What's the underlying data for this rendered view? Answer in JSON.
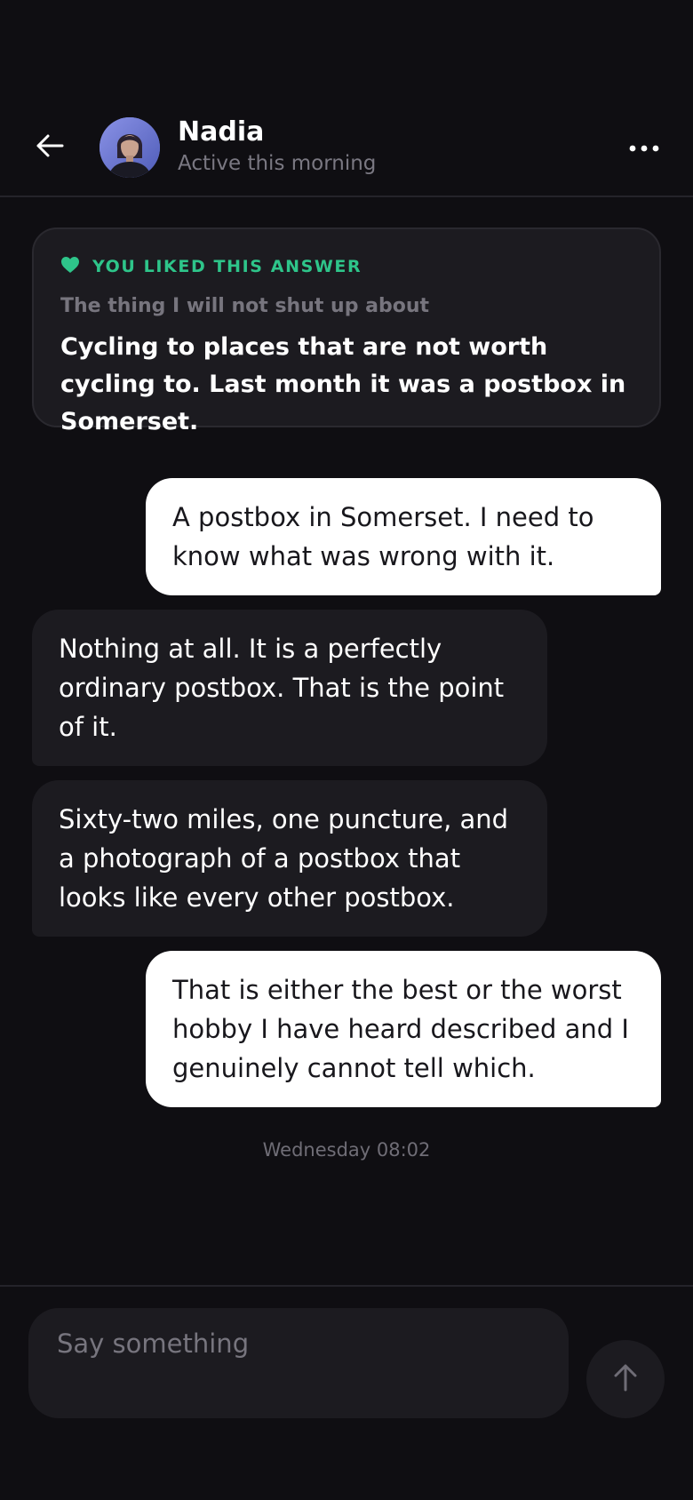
{
  "header": {
    "contact_name": "Nadia",
    "status": "Active this morning",
    "back_icon": "arrow-left-icon",
    "more_icon": "more-horizontal-icon"
  },
  "liked_answer": {
    "badge_icon": "heart-icon",
    "badge_label": "YOU LIKED THIS ANSWER",
    "prompt": "The thing I will not shut up about",
    "answer": "Cycling to places that are not worth cycling to. Last month it was a postbox in Somerset."
  },
  "messages": [
    {
      "direction": "outgoing",
      "text": "A postbox in Somerset. I need to know what was wrong with it."
    },
    {
      "direction": "incoming",
      "text": "Nothing at all. It is a perfectly ordinary postbox. That is the point of it."
    },
    {
      "direction": "incoming",
      "text": "Sixty-two miles, one puncture, and a photograph of a postbox that looks like every other postbox."
    },
    {
      "direction": "outgoing",
      "text": "That is either the best or the worst hobby I have heard described and I genuinely cannot tell which."
    }
  ],
  "timestamp": "Wednesday 08:02",
  "composer": {
    "placeholder": "Say something",
    "value": "",
    "send_icon": "arrow-up-icon"
  },
  "colors": {
    "background": "#0f0e12",
    "surface": "#1c1b20",
    "accent_green": "#2ec58a",
    "outgoing_bubble": "#ffffff",
    "muted_text": "#77757e"
  }
}
